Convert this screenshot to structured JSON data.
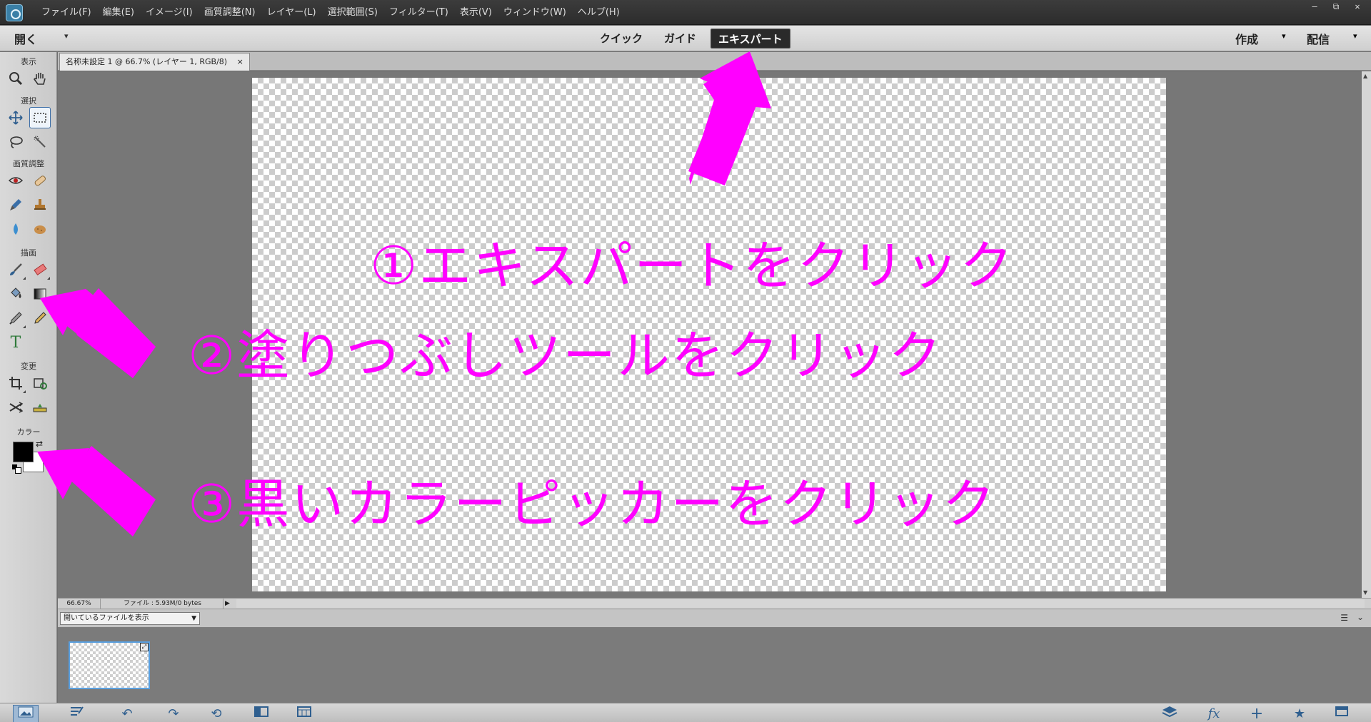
{
  "menu": {
    "items": [
      "ファイル(F)",
      "編集(E)",
      "イメージ(I)",
      "画質調整(N)",
      "レイヤー(L)",
      "選択範囲(S)",
      "フィルター(T)",
      "表示(V)",
      "ウィンドウ(W)",
      "ヘルプ(H)"
    ]
  },
  "window_controls": {
    "minimize": "–",
    "restore": "⧉",
    "close": "✕"
  },
  "modebar": {
    "open_label": "開く",
    "tabs": [
      "クイック",
      "ガイド",
      "エキスパート"
    ],
    "active_tab": "エキスパート",
    "create_label": "作成",
    "share_label": "配信",
    "dropdown_glyph": "▾"
  },
  "toolbox": {
    "sections": {
      "view": "表示",
      "select": "選択",
      "enhance": "画質調整",
      "draw": "描画",
      "modify": "変更",
      "color": "カラー"
    },
    "tools": {
      "zoom": "zoom-icon",
      "hand": "hand-icon",
      "move": "move-icon",
      "marquee": "marquee-icon",
      "lasso": "lasso-icon",
      "quick_select": "quick-selection-icon",
      "red_eye": "red-eye-icon",
      "spot_heal": "spot-healing-icon",
      "smart_brush": "smart-brush-icon",
      "clone_stamp": "clone-stamp-icon",
      "blur": "blur-icon",
      "sponge": "sponge-icon",
      "brush": "brush-icon",
      "eraser": "eraser-icon",
      "paint_bucket": "paint-bucket-icon",
      "gradient": "gradient-icon",
      "eyedropper": "eyedropper-icon",
      "type": "T",
      "pencil": "pencil-icon",
      "crop": "crop-icon",
      "recompose": "recompose-icon",
      "content_aware": "content-aware-move-icon",
      "straighten": "straighten-icon"
    },
    "foreground_color": "#000000",
    "background_color": "#ffffff"
  },
  "document": {
    "tab_title": "名称未設定 1 @ 66.7% (レイヤー 1, RGB/8)",
    "tab_close": "×"
  },
  "status": {
    "zoom": "66.67%",
    "file_info": "ファイル : 5.93M/0 bytes",
    "arrow": "▶"
  },
  "photo_bin": {
    "select_value": "開いているファイルを表示",
    "select_arrow": "▼"
  },
  "annotations": {
    "step1": "①エキスパートをクリック",
    "step2": "②塗りつぶしツールをクリック",
    "step3": "③黒いカラーピッカーをクリック",
    "color": "#ff00ff"
  }
}
